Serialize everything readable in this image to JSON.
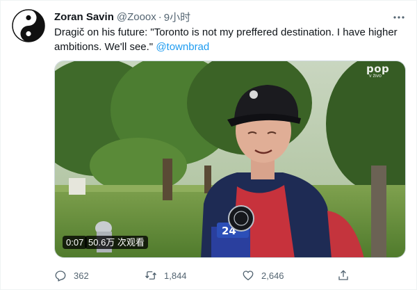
{
  "tweet": {
    "author_name": "Zoran Savin",
    "author_handle": "@Zooox",
    "separator": "·",
    "time": "9小时",
    "text_main": "Dragič on his future: \"Toronto is not my preffered destination. I have higher ambitions. We'll see.\" ",
    "mention": "@townbrad"
  },
  "video": {
    "channel_logo": "pop",
    "channel_sub": "v živo",
    "mic_text": "24",
    "duration": "0:07",
    "views": "50.6万 次观看"
  },
  "actions": {
    "reply": {
      "icon": "reply-icon",
      "count": "362"
    },
    "retweet": {
      "icon": "retweet-icon",
      "count": "1,844"
    },
    "like": {
      "icon": "heart-icon",
      "count": "2,646"
    },
    "share": {
      "icon": "share-icon"
    }
  },
  "colors": {
    "accent": "#1d9bf0",
    "text": "#0f1419",
    "muted": "#536471"
  }
}
